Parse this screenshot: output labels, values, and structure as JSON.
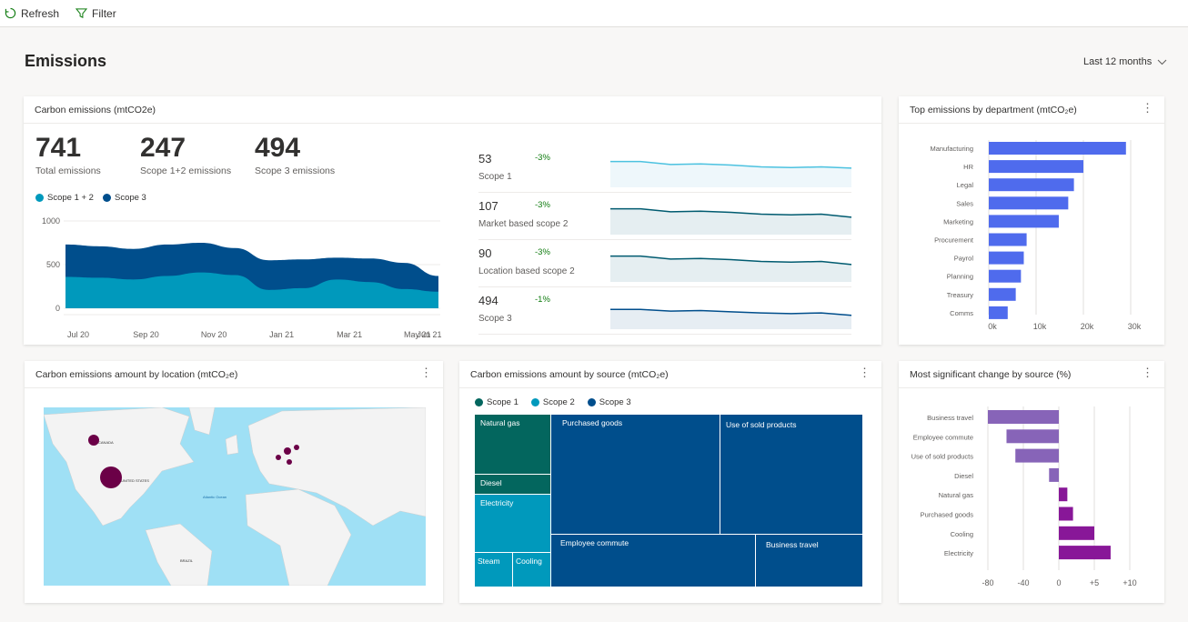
{
  "toolbar": {
    "refresh": "Refresh",
    "filter": "Filter"
  },
  "page": {
    "title": "Emissions",
    "range": "Last 12 months"
  },
  "colors": {
    "scope12": "#0099bc",
    "scope3": "#004e8c",
    "scope1": "#03665e",
    "dept_bar": "#4f6bed",
    "neg": "#8764b8",
    "pos": "#881798",
    "bubble": "#6b0047",
    "water": "#9fe0f5",
    "land": "#f3f3f3"
  },
  "carbon": {
    "title": "Carbon emissions (mtCO2e)",
    "kpis": [
      {
        "value": "741",
        "label": "Total emissions"
      },
      {
        "value": "247",
        "label": "Scope 1+2 emissions"
      },
      {
        "value": "494",
        "label": "Scope 3 emissions"
      }
    ],
    "chart_data": {
      "type": "area",
      "stacked": true,
      "categories": [
        "Jul 20",
        "Aug 20",
        "Sep 20",
        "Oct 20",
        "Nov 20",
        "Dec 20",
        "Jan 21",
        "Feb 21",
        "Mar 21",
        "Apr 21",
        "May 21",
        "Jun 21"
      ],
      "tick_labels": [
        "Jul 20",
        "Sep 20",
        "Nov 20",
        "Jan 21",
        "Mar 21",
        "May 21",
        "Jun 21"
      ],
      "yticks": [
        "1000",
        "500",
        "0"
      ],
      "ylim": [
        0,
        1000
      ],
      "series": [
        {
          "name": "Scope 1 + 2",
          "values": [
            360,
            350,
            330,
            370,
            410,
            380,
            210,
            230,
            330,
            300,
            220,
            190
          ]
        },
        {
          "name": "Scope 3",
          "values": [
            370,
            360,
            350,
            360,
            340,
            310,
            340,
            330,
            250,
            270,
            300,
            180
          ]
        }
      ],
      "legend": "top-left",
      "grid": true
    },
    "scopes": [
      {
        "value": "53",
        "change": "-3%",
        "label": "Scope 1",
        "color": "#4cc2e0",
        "fill": "#eef7fb",
        "trend": [
          80,
          80,
          70,
          72,
          68,
          62,
          60,
          62,
          58
        ]
      },
      {
        "value": "107",
        "change": "-3%",
        "label": "Market based scope 2",
        "color": "#005b70",
        "fill": "#e5eef1",
        "trend": [
          80,
          80,
          70,
          72,
          68,
          62,
          60,
          62,
          52
        ]
      },
      {
        "value": "90",
        "change": "-3%",
        "label": "Location based scope 2",
        "color": "#005b70",
        "fill": "#e5eef1",
        "trend": [
          80,
          80,
          70,
          72,
          68,
          62,
          60,
          62,
          52
        ]
      },
      {
        "value": "494",
        "change": "-1%",
        "label": "Scope 3",
        "color": "#004e8c",
        "fill": "#e6edf3",
        "trend": [
          60,
          60,
          54,
          56,
          52,
          48,
          46,
          48,
          40
        ]
      }
    ]
  },
  "dept": {
    "title": "Top emissions by department (mtCO₂e)",
    "chart_data": {
      "type": "bar",
      "orientation": "horizontal",
      "categories": [
        "Manufacturing",
        "HR",
        "Legal",
        "Sales",
        "Marketing",
        "Procurement",
        "Payrol",
        "Planning",
        "Treasury",
        "Comms"
      ],
      "values": [
        29000,
        20000,
        18000,
        16800,
        14800,
        8000,
        7400,
        6800,
        5700,
        4000
      ],
      "xlim": [
        0,
        30000
      ],
      "xticks": [
        "0k",
        "10k",
        "20k",
        "30k"
      ],
      "grid": true
    }
  },
  "location": {
    "title": "Carbon emissions amount by location (mtCO₂e)",
    "labels": [
      "CANADA",
      "UNITED STATES",
      "BRAZIL",
      "Atlantic Ocean"
    ]
  },
  "source": {
    "title": "Carbon emissions amount by source (mtCO₂e)",
    "legend": [
      "Scope 1",
      "Scope 2",
      "Scope 3"
    ],
    "cells": [
      {
        "label": "Natural gas",
        "scope": "Scope 1"
      },
      {
        "label": "Diesel",
        "scope": "Scope 1"
      },
      {
        "label": "Electricity",
        "scope": "Scope 2"
      },
      {
        "label": "Steam",
        "scope": "Scope 2"
      },
      {
        "label": "Cooling",
        "scope": "Scope 2"
      },
      {
        "label": "Purchased goods",
        "scope": "Scope 3"
      },
      {
        "label": "Use of sold products",
        "scope": "Scope 3"
      },
      {
        "label": "Employee commute",
        "scope": "Scope 3"
      },
      {
        "label": "Business travel",
        "scope": "Scope 3"
      }
    ]
  },
  "change": {
    "title": "Most significant change by source (%)",
    "chart_data": {
      "type": "bar",
      "orientation": "horizontal",
      "categories": [
        "Business travel",
        "Employee commute",
        "Use of sold products",
        "Diesel",
        "Natural gas",
        "Purchased goods",
        "Cooling",
        "Electricity"
      ],
      "values": [
        -80,
        -59,
        -49,
        -11,
        1.2,
        2,
        5,
        7.3
      ],
      "xticks": [
        "-80",
        "-40",
        "0",
        "+5",
        "+10"
      ],
      "xtick_values": [
        -80,
        -40,
        0,
        5,
        10
      ],
      "grid": true
    }
  }
}
